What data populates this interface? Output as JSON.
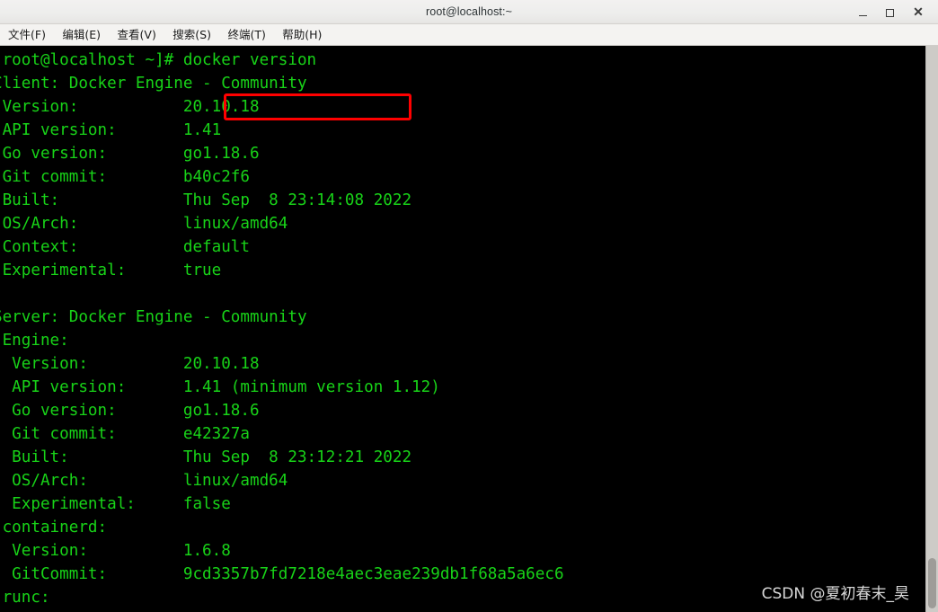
{
  "window": {
    "title": "root@localhost:~",
    "controls": {
      "minimize": "–",
      "maximize": "□",
      "close": "×"
    }
  },
  "menubar": {
    "items": [
      {
        "label": "文件(F)"
      },
      {
        "label": "编辑(E)"
      },
      {
        "label": "查看(V)"
      },
      {
        "label": "搜索(S)"
      },
      {
        "label": "终端(T)"
      },
      {
        "label": "帮助(H)"
      }
    ]
  },
  "terminal": {
    "prompt": "[root@localhost ~]#",
    "command": "docker version",
    "foreground_color": "#18d318",
    "background_color": "#000000",
    "highlight_color": "#ff0000",
    "lines": [
      "[root@localhost ~]# docker version",
      "Client: Docker Engine - Community",
      " Version:           20.10.18",
      " API version:       1.41",
      " Go version:        go1.18.6",
      " Git commit:        b40c2f6",
      " Built:             Thu Sep  8 23:14:08 2022",
      " OS/Arch:           linux/amd64",
      " Context:           default",
      " Experimental:      true",
      "",
      "Server: Docker Engine - Community",
      " Engine:",
      "  Version:          20.10.18",
      "  API version:      1.41 (minimum version 1.12)",
      "  Go version:       go1.18.6",
      "  Git commit:       e42327a",
      "  Built:            Thu Sep  8 23:12:21 2022",
      "  OS/Arch:          linux/amd64",
      "  Experimental:     false",
      " containerd:",
      "  Version:          1.6.8",
      "  GitCommit:        9cd3357b7fd7218e4aec3eae239db1f68a5a6ec6",
      " runc:"
    ],
    "client": {
      "header": "Client: Docker Engine - Community",
      "version": "20.10.18",
      "api_version": "1.41",
      "go_version": "go1.18.6",
      "git_commit": "b40c2f6",
      "built": "Thu Sep  8 23:14:08 2022",
      "os_arch": "linux/amd64",
      "context": "default",
      "experimental": "true"
    },
    "server": {
      "header": "Server: Docker Engine - Community",
      "engine": {
        "version": "20.10.18",
        "api_version": "1.41 (minimum version 1.12)",
        "go_version": "go1.18.6",
        "git_commit": "e42327a",
        "built": "Thu Sep  8 23:12:21 2022",
        "os_arch": "linux/amd64",
        "experimental": "false"
      },
      "containerd": {
        "version": "1.6.8",
        "git_commit": "9cd3357b7fd7218e4aec3eae239db1f68a5a6ec6"
      },
      "runc": ""
    }
  },
  "watermark": {
    "text": "CSDN @夏初春末_昊"
  }
}
